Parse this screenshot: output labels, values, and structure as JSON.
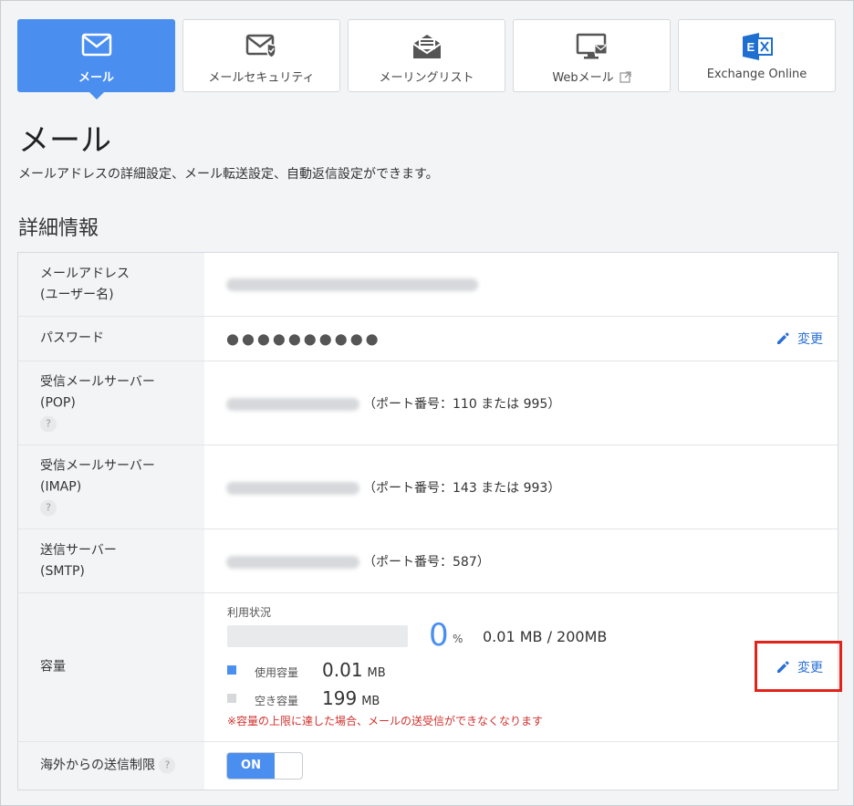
{
  "tabs": [
    {
      "label": "メール",
      "icon": "mail-icon",
      "active": true
    },
    {
      "label": "メールセキュリティ",
      "icon": "mail-shield-icon"
    },
    {
      "label": "メーリングリスト",
      "icon": "mailing-list-icon"
    },
    {
      "label": "Webメール",
      "icon": "monitor-mail-icon",
      "external": true
    },
    {
      "label": "Exchange Online",
      "icon": "exchange-icon"
    }
  ],
  "page": {
    "title": "メール",
    "description": "メールアドレスの詳細設定、メール転送設定、自動返信設定ができます。",
    "section_title": "詳細情報"
  },
  "details": {
    "email": {
      "label_1": "メールアドレス",
      "label_2": "(ユーザー名)"
    },
    "password": {
      "label": "パスワード",
      "value": "●●●●●●●●●●",
      "edit": "変更"
    },
    "pop": {
      "label_1": "受信メールサーバー",
      "label_2": "(POP)",
      "help": "?",
      "port": "（ポート番号：110 または 995）"
    },
    "imap": {
      "label_1": "受信メールサーバー",
      "label_2": "(IMAP)",
      "help": "?",
      "port": "（ポート番号：143 または 993）"
    },
    "smtp": {
      "label_1": "送信サーバー",
      "label_2": "(SMTP)",
      "port": "（ポート番号：587）"
    },
    "capacity": {
      "label": "容量",
      "usage_label": "利用状況",
      "percent": "0",
      "percent_sign": "%",
      "usage_fraction": 0.0,
      "total": "0.01 MB / 200MB",
      "used_label": "使用容量",
      "used_value": "0.01",
      "used_unit": "MB",
      "free_label": "空き容量",
      "free_value": "199",
      "free_unit": "MB",
      "warning": "※容量の上限に達した場合、メールの送受信ができなくなります",
      "edit": "変更"
    },
    "overseas": {
      "label": "海外からの送信制限",
      "help": "?",
      "toggle": "ON"
    }
  },
  "colors": {
    "accent": "#4a8ef0",
    "link": "#2a6fd6",
    "warning": "#d0312d",
    "highlight": "#e0241b",
    "free": "#d6d8db"
  }
}
